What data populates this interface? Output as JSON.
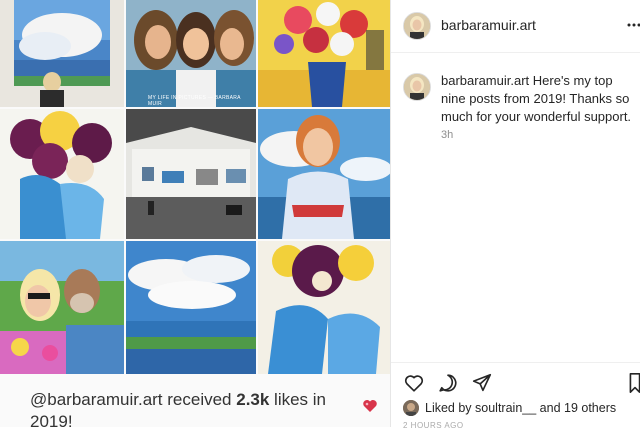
{
  "post": {
    "grid_overlay_text": "MY LIFE IN PICTURES — BARBARA MUIR",
    "summary": {
      "handle": "@barbaramuir.art",
      "text_middle": " received ",
      "likes_count": "2.3k",
      "text_end": " likes in 2019!"
    }
  },
  "sidebar": {
    "header": {
      "username": "barbaramuir.art",
      "more_icon": "more-dots-icon"
    },
    "caption": {
      "username": "barbaramuir.art",
      "text": " Here's my top nine posts from 2019! Thanks so much for your wonderful support.",
      "time": "3h"
    },
    "actions": {
      "icons": [
        "heart-icon",
        "comment-icon",
        "share-icon",
        "bookmark-icon"
      ]
    },
    "likes": {
      "prefix": "Liked by ",
      "user": "soultrain__",
      "middle": " and ",
      "others": "19 others"
    },
    "date": "2 HOURS AGO"
  },
  "colors": {
    "accent_blue": "#3a7bd5",
    "text": "#262626",
    "muted": "#8e8e8e",
    "border": "#efefef"
  }
}
